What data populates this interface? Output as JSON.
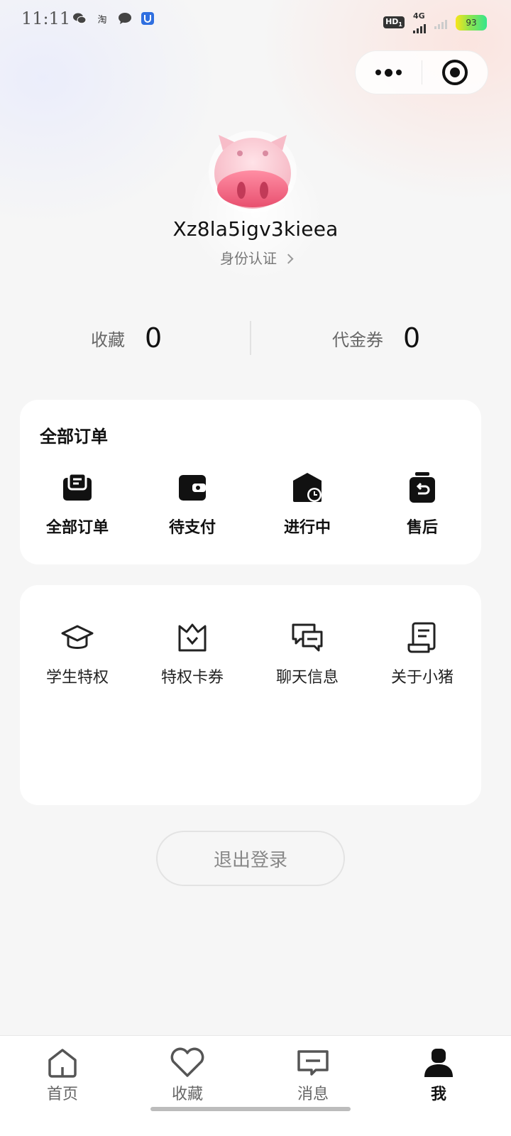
{
  "status_bar": {
    "time": "11:11",
    "left_icons": [
      "wechat-icon",
      "taobao-icon",
      "message-icon",
      "app-notification-icon"
    ],
    "taobao_text": "淘",
    "hd_text": "HD",
    "hd_sub": "1",
    "network": "4G",
    "battery": "93"
  },
  "capsule": {
    "more_icon": "more-dots-icon",
    "close_icon": "target-icon"
  },
  "profile": {
    "username": "Xz8la5igv3kieea",
    "verify_label": "身份认证"
  },
  "stats": [
    {
      "label": "收藏",
      "value": "0"
    },
    {
      "label": "代金券",
      "value": "0"
    }
  ],
  "orders": {
    "title": "全部订单",
    "items": [
      {
        "label": "全部订单",
        "icon": "order-list-icon"
      },
      {
        "label": "待支付",
        "icon": "wallet-icon"
      },
      {
        "label": "进行中",
        "icon": "in-progress-icon"
      },
      {
        "label": "售后",
        "icon": "after-sales-icon"
      }
    ]
  },
  "tools": {
    "items": [
      {
        "label": "学生特权",
        "icon": "graduation-cap-icon"
      },
      {
        "label": "特权卡券",
        "icon": "crown-icon"
      },
      {
        "label": "聊天信息",
        "icon": "chat-bubbles-icon"
      },
      {
        "label": "关于小猪",
        "icon": "document-icon"
      }
    ]
  },
  "logout_label": "退出登录",
  "tabbar": {
    "active": "我",
    "items": [
      {
        "label": "首页",
        "icon": "home-icon"
      },
      {
        "label": "收藏",
        "icon": "heart-icon"
      },
      {
        "label": "消息",
        "icon": "message-box-icon"
      },
      {
        "label": "我",
        "icon": "person-icon"
      }
    ]
  }
}
